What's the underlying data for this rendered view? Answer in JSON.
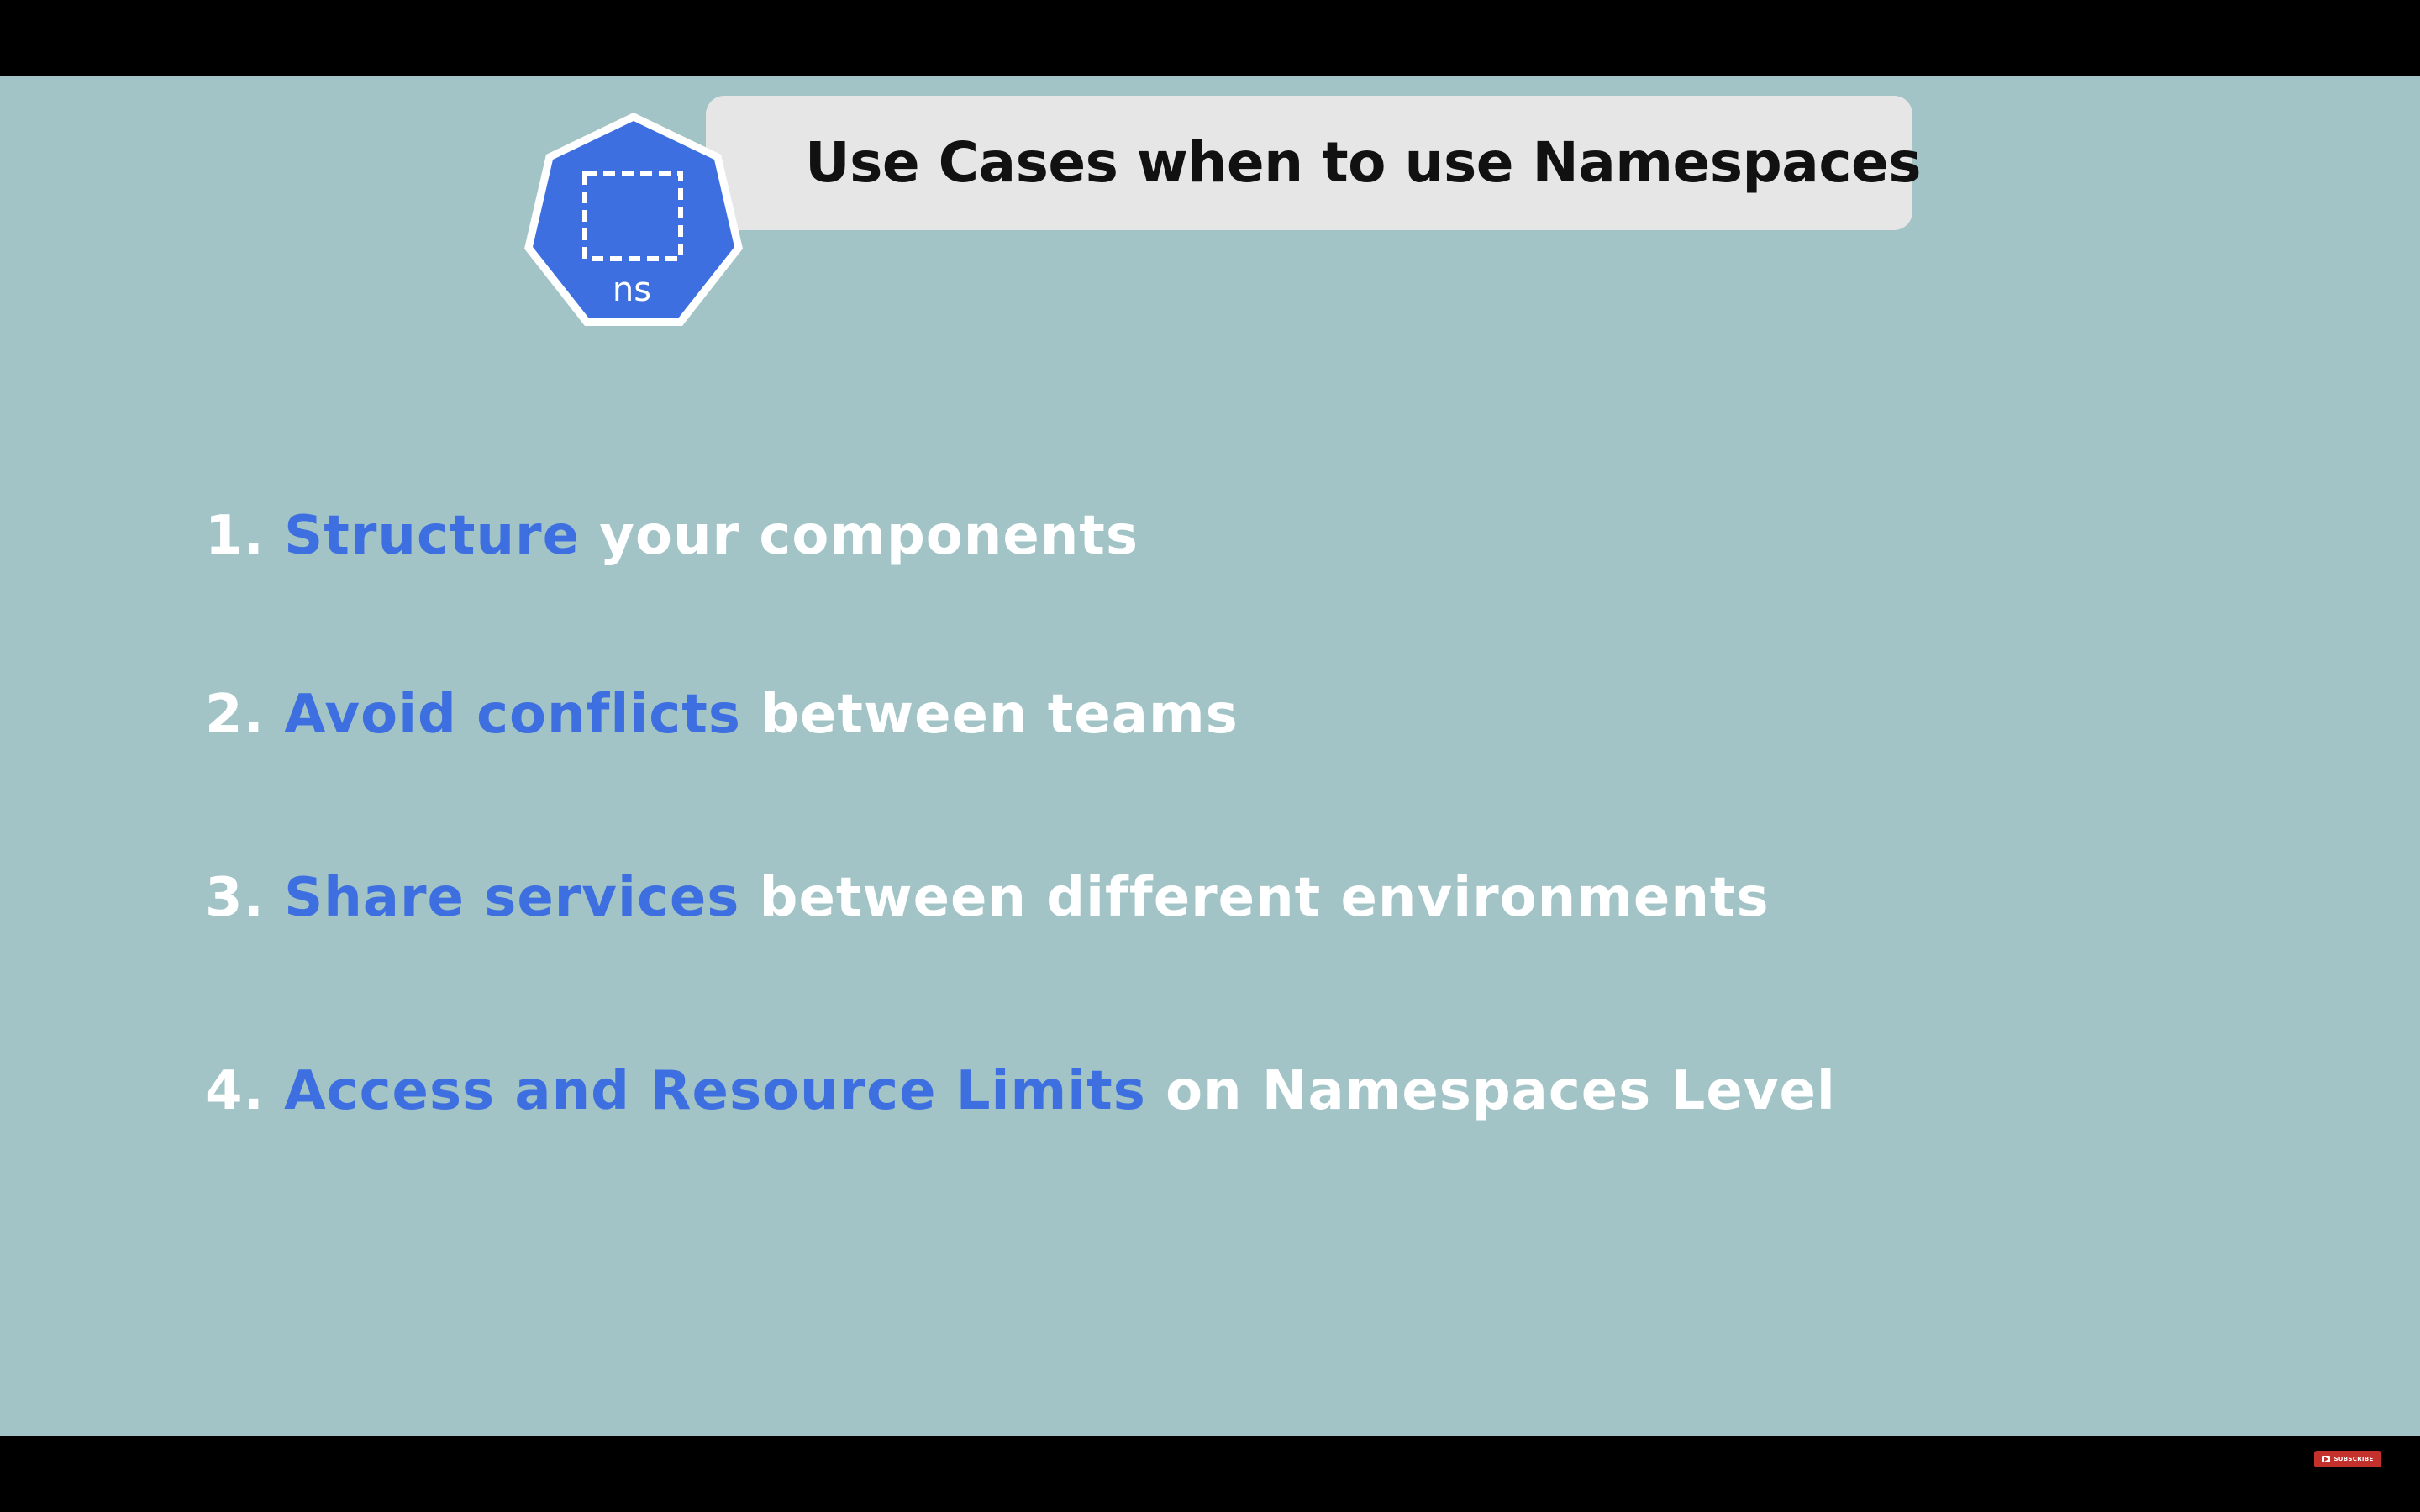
{
  "slide": {
    "title": "Use Cases when to use Namespaces",
    "icon_label": "ns",
    "colors": {
      "background": "#a2c4c6",
      "highlight": "#3d6fe0",
      "text": "#ffffff",
      "title_bar": "#e6e6e6",
      "icon": "#3d6fe0"
    }
  },
  "list": [
    {
      "number": "1.",
      "highlight": "Structure",
      "rest": "your components"
    },
    {
      "number": "2.",
      "highlight": "Avoid conflicts",
      "rest": "between teams"
    },
    {
      "number": "3.",
      "highlight": "Share services",
      "rest": "between different environments"
    },
    {
      "number": "4.",
      "highlight": "Access and Resource Limits",
      "rest": "on Namespaces Level"
    }
  ],
  "player": {
    "subscribe_label": "SUBSCRIBE"
  }
}
